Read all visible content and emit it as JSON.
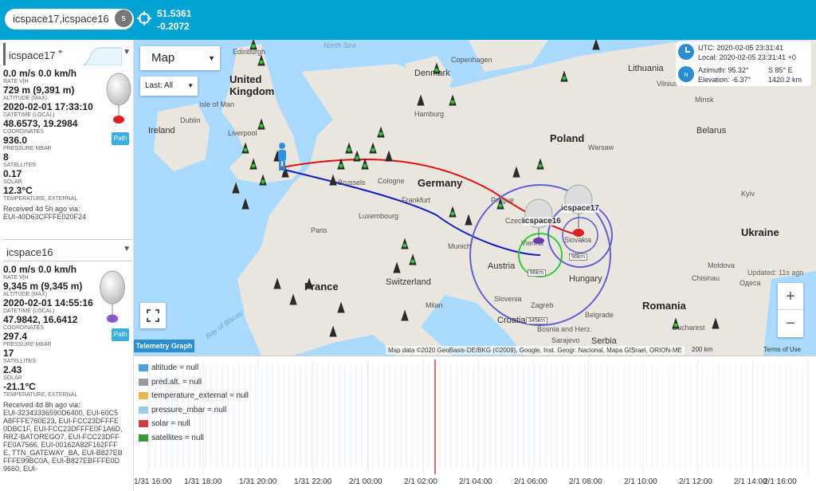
{
  "search": {
    "value": "icspace17,icspace16",
    "button_label": "s"
  },
  "coords": {
    "lat": "51.5361",
    "lon": "-0.2072"
  },
  "sidebar": {
    "cards": [
      {
        "name": "icspace17",
        "rate": "0.0 m/s 0.0 km/h",
        "rate_label": "RATE V|H",
        "altitude": "729 m (9,391 m)",
        "altitude_label": "ALTITUDE (MAX)",
        "datetime": "2020-02-01 17:33:10",
        "datetime_label": "DATETIME (LOCAL)",
        "coords": "48.6573, 19.2984",
        "coords_label": "COORDINATES",
        "pressure": "936.0",
        "pressure_label": "PRESSURE MBAR",
        "satellites": "8",
        "satellites_label": "SATELLITES",
        "solar": "0.17",
        "solar_label": "SOLAR",
        "temp": "12.3°C",
        "temp_label": "TEMPERATURE, EXTERNAL",
        "received": "Received 4d 5h ago via:",
        "via": "EUI-40D63CFFFE020F24",
        "path_label": "Path",
        "marker_color": "#e02020"
      },
      {
        "name": "icspace16",
        "rate": "0.0 m/s 0.0 km/h",
        "rate_label": "RATE V|H",
        "altitude": "9,345 m (9,345 m)",
        "altitude_label": "ALTITUDE (MAX)",
        "datetime": "2020-02-01 14:55:16",
        "datetime_label": "DATETIME (LOCAL)",
        "coords": "47.9842, 16.6412",
        "coords_label": "COORDINATES",
        "pressure": "297.4",
        "pressure_label": "PRESSURE MBAR",
        "satellites": "17",
        "satellites_label": "SATELLITES",
        "solar": "2.43",
        "solar_label": "SOLAR",
        "temp": "-21.1°C",
        "temp_label": "TEMPERATURE, EXTERNAL",
        "received": "Received 4d 8h ago via:",
        "via": "EUI-32343336590D6400, EUI-60C5A8FFFE760E23, EUI-FCC23DFFFE0DBC1F, EUI-FCC23DFFFE0F1A6D, RRZ-BATOREGO7, EUI-FCC23DFFFE0A7566, EUI-00162A82F162FFFE, TTN_GATEWAY_BA, EUI-B827EBFFFE99BC0A, EUI-B827EBFFFE0D9660, EUI-",
        "path_label": "Path",
        "marker_color": "#8a5ad0"
      }
    ]
  },
  "map": {
    "type_label": "Map",
    "last_label": "Last: All",
    "utc": "UTC: 2020-02-05 23:31:41",
    "local": "Local: 2020-02-05 23:31:41 +0",
    "azimuth": "Azimuth: 95.32°",
    "azimuth_dir": "S 85° E",
    "elevation": "Elevation: -6.37°",
    "distance": "1420.2 km",
    "updated": "Updated: 11s ago",
    "attribution": "Map data ©2020 GeoBasis-DE/BKG (©2009), Google, Inst. Geogr. Nacional, Mapa GISrael, ORION-ME",
    "scale": "200 km",
    "terms": "Terms of Use",
    "zoom_in": "+",
    "zoom_out": "−",
    "labels": {
      "north_sea": "North Sea",
      "united_kingdom": "United Kingdom",
      "ireland": "Ireland",
      "dublin": "Dublin",
      "isle_of_man": "Isle of Man",
      "edinburgh": "Edinburgh",
      "liverpool": "Liverpool",
      "denmark": "Denmark",
      "copenhagen": "Copenhagen",
      "hamburg": "Hamburg",
      "germany": "Germany",
      "poland": "Poland",
      "warsaw": "Warsaw",
      "lithuania": "Lithuania",
      "vilnius": "Vilnius",
      "minsk": "Minsk",
      "belarus": "Belarus",
      "kyiv": "Kyiv",
      "ukraine": "Ukraine",
      "cologne": "Cologne",
      "frankfurt": "Frankfurt",
      "brussels": "Brussels",
      "luxembourg": "Luxembourg",
      "paris": "Paris",
      "france": "France",
      "prague": "Prague",
      "czech": "Czech",
      "slovakia": "Slovakia",
      "austria": "Austria",
      "munich": "Munich",
      "vienna": "Vienna",
      "switzerland": "Switzerland",
      "hungary": "Hungary",
      "slovenia": "Slovenia",
      "zagreb": "Zagreb",
      "croatia": "Croatia",
      "bosnia": "Bosnia and Herz.",
      "belgrade": "Belgrade",
      "serbia": "Serbia",
      "romania": "Romania",
      "bucharest": "Bucharest",
      "moldova": "Moldova",
      "chisinau": "Chisinau",
      "odesa": "Одеса",
      "milan": "Milan",
      "bay_of_biscay": "Bay of Biscay",
      "sarajevo": "Sarajevo"
    },
    "balloon_labels": {
      "icspace16": "icspace16",
      "icspace17": "icspace17"
    },
    "range_labels": {
      "r96": "96km",
      "r96b": "96km",
      "r345": "345km"
    }
  },
  "telemetry": {
    "tab_label": "Telemetry Graph",
    "legend": [
      {
        "label": "altitude = null",
        "color": "#4aa3df"
      },
      {
        "label": "pred.alt. = null",
        "color": "#999999"
      },
      {
        "label": "temperature_external = null",
        "color": "#e8b84a"
      },
      {
        "label": "pressure_mbar = null",
        "color": "#9ecae8"
      },
      {
        "label": "solar = null",
        "color": "#d04040"
      },
      {
        "label": "satellites = null",
        "color": "#3a9a3a"
      }
    ],
    "x_ticks": [
      "1/31 16:00",
      "1/31 18:00",
      "1/31 20:00",
      "1/31 22:00",
      "2/1 00:00",
      "2/1 02:00",
      "2/1 04:00",
      "2/1 06:00",
      "2/1 08:00",
      "2/1 10:00",
      "2/1 12:00",
      "2/1 14:00",
      "2/1 16:00"
    ]
  }
}
